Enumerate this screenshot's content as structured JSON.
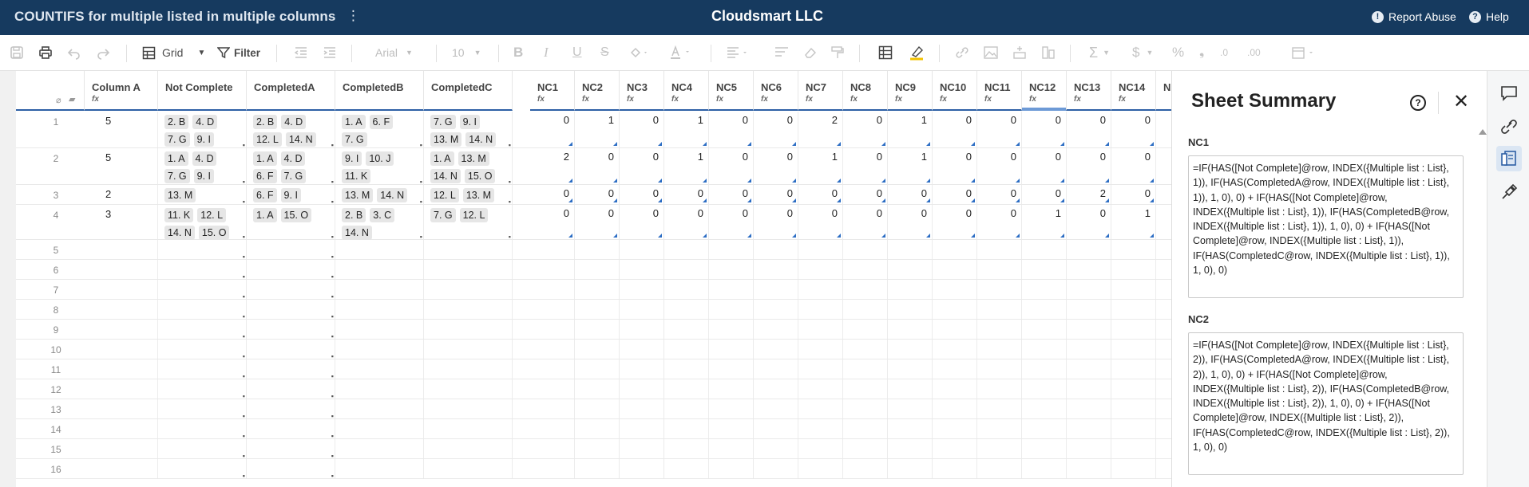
{
  "topbar": {
    "doc_title": "COUNTIFS for multiple listed in multiple columns",
    "menu_glyph": "⋮",
    "org_name": "Cloudsmart LLC",
    "report_abuse": "Report Abuse",
    "help": "Help"
  },
  "toolbar": {
    "view_label": "Grid",
    "filter_label": "Filter",
    "font_name": "Arial",
    "font_size": "10"
  },
  "grid": {
    "columns": [
      "Column A",
      "Not Complete",
      "CompletedA",
      "CompletedB",
      "CompletedC",
      "NC1",
      "NC2",
      "NC3",
      "NC4",
      "NC5",
      "NC6",
      "NC7",
      "NC8",
      "NC9",
      "NC10",
      "NC11",
      "NC12",
      "NC13",
      "NC14",
      "N"
    ],
    "selected_column": "NC12",
    "rows": [
      {
        "n": "1",
        "a": "5",
        "nc": [
          "2. B",
          "4. D",
          "7. G",
          "9. I"
        ],
        "ca": [
          "2. B",
          "4. D",
          "12. L",
          "14. N"
        ],
        "cb": [
          "1. A",
          "6. F",
          "7. G"
        ],
        "cc": [
          "7. G",
          "9. I",
          "13. M",
          "14. N"
        ],
        "nums": [
          "0",
          "1",
          "0",
          "1",
          "0",
          "0",
          "2",
          "0",
          "1",
          "0",
          "0",
          "0",
          "0",
          "0"
        ]
      },
      {
        "n": "2",
        "a": "5",
        "nc": [
          "1. A",
          "4. D",
          "7. G",
          "9. I"
        ],
        "ca": [
          "1. A",
          "4. D",
          "6. F",
          "7. G"
        ],
        "cb": [
          "9. I",
          "10. J",
          "11. K"
        ],
        "cc": [
          "1. A",
          "13. M",
          "14. N",
          "15. O"
        ],
        "nums": [
          "2",
          "0",
          "0",
          "1",
          "0",
          "0",
          "1",
          "0",
          "1",
          "0",
          "0",
          "0",
          "0",
          "0"
        ]
      },
      {
        "n": "3",
        "a": "2",
        "nc": [
          "13. M"
        ],
        "ca": [
          "6. F",
          "9. I"
        ],
        "cb": [
          "13. M",
          "14. N"
        ],
        "cc": [
          "12. L",
          "13. M"
        ],
        "nums": [
          "0",
          "0",
          "0",
          "0",
          "0",
          "0",
          "0",
          "0",
          "0",
          "0",
          "0",
          "0",
          "2",
          "0"
        ]
      },
      {
        "n": "4",
        "a": "3",
        "nc": [
          "11. K",
          "12. L",
          "14. N",
          "15. O"
        ],
        "ca": [
          "1. A",
          "15. O"
        ],
        "cb": [
          "2. B",
          "3. C",
          "14. N"
        ],
        "cc": [
          "7. G",
          "12. L"
        ],
        "nums": [
          "0",
          "0",
          "0",
          "0",
          "0",
          "0",
          "0",
          "0",
          "0",
          "0",
          "0",
          "1",
          "0",
          "1"
        ]
      }
    ],
    "empty_rows": [
      "5",
      "6",
      "7",
      "8",
      "9",
      "10",
      "11",
      "12",
      "13",
      "14",
      "15",
      "16"
    ]
  },
  "panel": {
    "title": "Sheet Summary",
    "fields": [
      {
        "label": "NC1",
        "formula": "=IF(HAS([Not Complete]@row, INDEX({Multiple list : List}, 1)), IF(HAS(CompletedA@row, INDEX({Multiple list : List}, 1)), 1, 0), 0) + IF(HAS([Not Complete]@row, INDEX({Multiple list : List}, 1)), IF(HAS(CompletedB@row, INDEX({Multiple list : List}, 1)), 1, 0), 0) + IF(HAS([Not Complete]@row, INDEX({Multiple list : List}, 1)), IF(HAS(CompletedC@row, INDEX({Multiple list : List}, 1)), 1, 0), 0)"
      },
      {
        "label": "NC2",
        "formula": "=IF(HAS([Not Complete]@row, INDEX({Multiple list : List}, 2)), IF(HAS(CompletedA@row, INDEX({Multiple list : List}, 2)), 1, 0), 0) + IF(HAS([Not Complete]@row, INDEX({Multiple list : List}, 2)), IF(HAS(CompletedB@row, INDEX({Multiple list : List}, 2)), 1, 0), 0) + IF(HAS([Not Complete]@row, INDEX({Multiple list : List}, 2)), IF(HAS(CompletedC@row, INDEX({Multiple list : List}, 2)), 1, 0), 0)"
      }
    ]
  },
  "rail": {
    "icons": [
      "comments-icon",
      "attachments-icon",
      "sheet-summary-icon",
      "activity-icon"
    ],
    "active": "sheet-summary-icon"
  },
  "colors": {
    "topbar": "#163a5f",
    "accent": "#2d5fa5",
    "chip": "#e6e6e6"
  }
}
